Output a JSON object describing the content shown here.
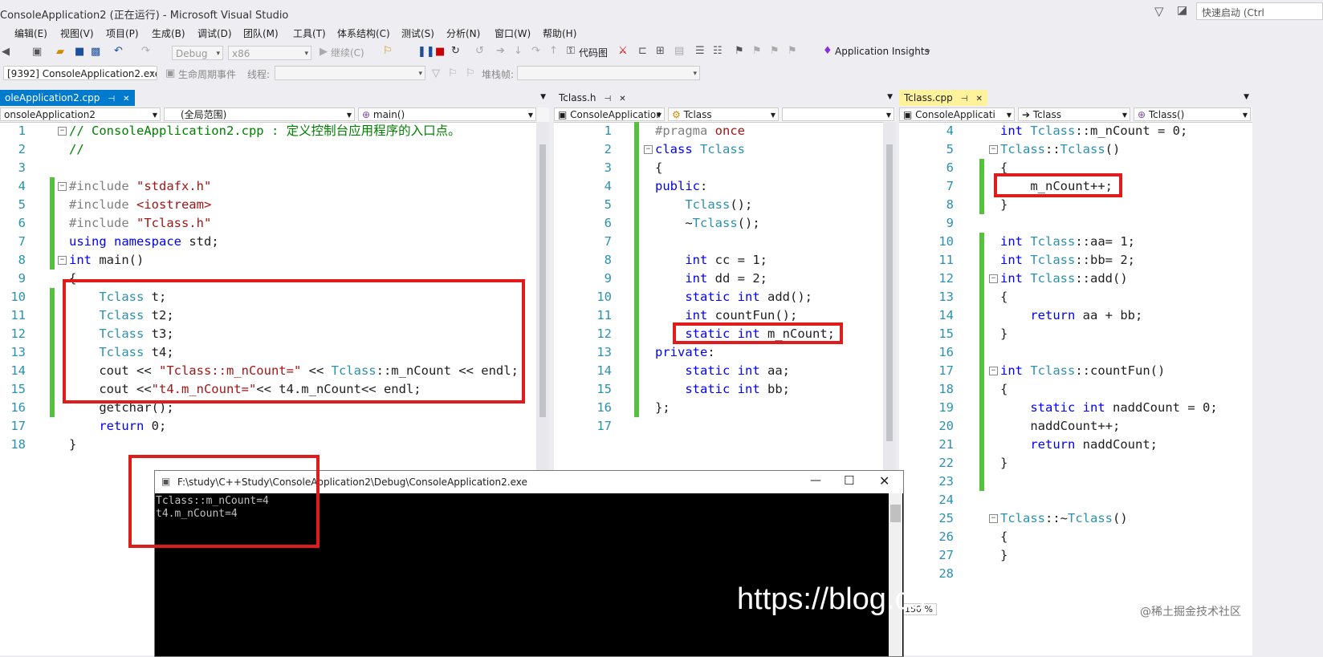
{
  "window": {
    "title": "ConsoleApplication2 (正在运行) - Microsoft Visual Studio",
    "quick_launch_placeholder": "快速启动 (Ctrl"
  },
  "menu": [
    "编辑(E)",
    "视图(V)",
    "项目(P)",
    "生成(B)",
    "调试(D)",
    "团队(M)",
    "工具(T)",
    "体系结构(C)",
    "测试(S)",
    "分析(N)",
    "窗口(W)",
    "帮助(H)"
  ],
  "toolbar": {
    "config": "Debug",
    "platform": "x86",
    "continue_label": "继续(C)",
    "codemap_label": "代码图",
    "app_insights_label": "Application Insights"
  },
  "debugbar": {
    "process": "[9392] ConsoleApplication2.exe",
    "lifecycle_label": "生命周期事件",
    "thread_label": "线程:",
    "stackframe_label": "堆栈帧:"
  },
  "panes": {
    "left": {
      "tab": "oleApplication2.cpp",
      "nav": [
        "onsoleApplication2",
        "(全局范围)",
        "main()"
      ]
    },
    "middle": {
      "tab": "Tclass.h",
      "nav": [
        "ConsoleApplicatior",
        "Tclass",
        ""
      ]
    },
    "right": {
      "tab": "Tclass.cpp",
      "nav": [
        "ConsoleApplicati",
        "Tclass",
        "Tclass()"
      ],
      "zoom": "150 %"
    }
  },
  "code": {
    "left": [
      "// ConsoleApplication2.cpp : 定义控制台应用程序的入口点。",
      "//",
      "",
      "#include \"stdafx.h\"",
      "#include <iostream>",
      "#include \"Tclass.h\"",
      "using namespace std;",
      "int main()",
      "{",
      "    Tclass t;",
      "    Tclass t2;",
      "    Tclass t3;",
      "    Tclass t4;",
      "    cout << \"Tclass::m_nCount=\" << Tclass::m_nCount << endl;",
      "    cout <<\"t4.m_nCount=\"<< t4.m_nCount<< endl;",
      "    getchar();",
      "    return 0;",
      "}"
    ],
    "middle": [
      "#pragma once",
      "class Tclass",
      "{",
      "public:",
      "    Tclass();",
      "    ~Tclass();",
      "",
      "    int cc = 1;",
      "    int dd = 2;",
      "    static int add();",
      "    int countFun();",
      "    static int m_nCount;",
      "private:",
      "    static int aa;",
      "    static int bb;",
      "};",
      ""
    ],
    "right": [
      "int Tclass::m_nCount = 0;",
      "Tclass::Tclass()",
      "{",
      "    m_nCount++;",
      "}",
      "",
      "int Tclass::aa= 1;",
      "int Tclass::bb= 2;",
      "int Tclass::add()",
      "{",
      "    return aa + bb;",
      "}",
      "",
      "int Tclass::countFun()",
      "{",
      "    static int naddCount = 0;",
      "    naddCount++;",
      "    return naddCount;",
      "}",
      "",
      "",
      "Tclass::~Tclass()",
      "{",
      "}",
      ""
    ],
    "right_start_line": 4
  },
  "console": {
    "title": "F:\\study\\C++Study\\ConsoleApplication2\\Debug\\ConsoleApplication2.exe",
    "lines": [
      "Tclass::m_nCount=4",
      "t4.m_nCount=4"
    ]
  },
  "watermark": "https://blog.cs",
  "watermark2": "@稀土掘金技术社区",
  "colors": {
    "accent": "#007acc",
    "highlight_box": "#e01b1b",
    "console_bg": "#000000"
  }
}
